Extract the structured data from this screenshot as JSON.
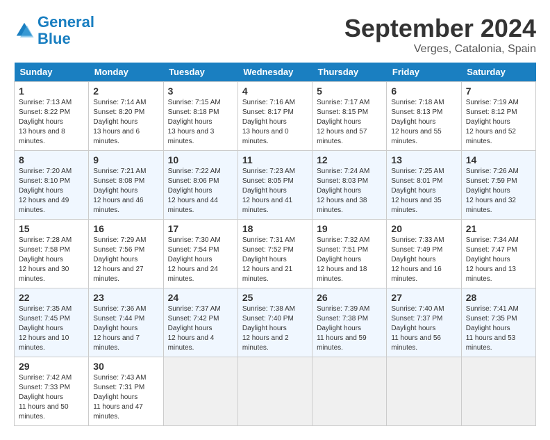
{
  "header": {
    "logo_line1": "General",
    "logo_line2": "Blue",
    "month": "September 2024",
    "location": "Verges, Catalonia, Spain"
  },
  "days_of_week": [
    "Sunday",
    "Monday",
    "Tuesday",
    "Wednesday",
    "Thursday",
    "Friday",
    "Saturday"
  ],
  "weeks": [
    [
      {
        "day": "1",
        "sunrise": "7:13 AM",
        "sunset": "8:22 PM",
        "daylight": "13 hours and 8 minutes."
      },
      {
        "day": "2",
        "sunrise": "7:14 AM",
        "sunset": "8:20 PM",
        "daylight": "13 hours and 6 minutes."
      },
      {
        "day": "3",
        "sunrise": "7:15 AM",
        "sunset": "8:18 PM",
        "daylight": "13 hours and 3 minutes."
      },
      {
        "day": "4",
        "sunrise": "7:16 AM",
        "sunset": "8:17 PM",
        "daylight": "13 hours and 0 minutes."
      },
      {
        "day": "5",
        "sunrise": "7:17 AM",
        "sunset": "8:15 PM",
        "daylight": "12 hours and 57 minutes."
      },
      {
        "day": "6",
        "sunrise": "7:18 AM",
        "sunset": "8:13 PM",
        "daylight": "12 hours and 55 minutes."
      },
      {
        "day": "7",
        "sunrise": "7:19 AM",
        "sunset": "8:12 PM",
        "daylight": "12 hours and 52 minutes."
      }
    ],
    [
      {
        "day": "8",
        "sunrise": "7:20 AM",
        "sunset": "8:10 PM",
        "daylight": "12 hours and 49 minutes."
      },
      {
        "day": "9",
        "sunrise": "7:21 AM",
        "sunset": "8:08 PM",
        "daylight": "12 hours and 46 minutes."
      },
      {
        "day": "10",
        "sunrise": "7:22 AM",
        "sunset": "8:06 PM",
        "daylight": "12 hours and 44 minutes."
      },
      {
        "day": "11",
        "sunrise": "7:23 AM",
        "sunset": "8:05 PM",
        "daylight": "12 hours and 41 minutes."
      },
      {
        "day": "12",
        "sunrise": "7:24 AM",
        "sunset": "8:03 PM",
        "daylight": "12 hours and 38 minutes."
      },
      {
        "day": "13",
        "sunrise": "7:25 AM",
        "sunset": "8:01 PM",
        "daylight": "12 hours and 35 minutes."
      },
      {
        "day": "14",
        "sunrise": "7:26 AM",
        "sunset": "7:59 PM",
        "daylight": "12 hours and 32 minutes."
      }
    ],
    [
      {
        "day": "15",
        "sunrise": "7:28 AM",
        "sunset": "7:58 PM",
        "daylight": "12 hours and 30 minutes."
      },
      {
        "day": "16",
        "sunrise": "7:29 AM",
        "sunset": "7:56 PM",
        "daylight": "12 hours and 27 minutes."
      },
      {
        "day": "17",
        "sunrise": "7:30 AM",
        "sunset": "7:54 PM",
        "daylight": "12 hours and 24 minutes."
      },
      {
        "day": "18",
        "sunrise": "7:31 AM",
        "sunset": "7:52 PM",
        "daylight": "12 hours and 21 minutes."
      },
      {
        "day": "19",
        "sunrise": "7:32 AM",
        "sunset": "7:51 PM",
        "daylight": "12 hours and 18 minutes."
      },
      {
        "day": "20",
        "sunrise": "7:33 AM",
        "sunset": "7:49 PM",
        "daylight": "12 hours and 16 minutes."
      },
      {
        "day": "21",
        "sunrise": "7:34 AM",
        "sunset": "7:47 PM",
        "daylight": "12 hours and 13 minutes."
      }
    ],
    [
      {
        "day": "22",
        "sunrise": "7:35 AM",
        "sunset": "7:45 PM",
        "daylight": "12 hours and 10 minutes."
      },
      {
        "day": "23",
        "sunrise": "7:36 AM",
        "sunset": "7:44 PM",
        "daylight": "12 hours and 7 minutes."
      },
      {
        "day": "24",
        "sunrise": "7:37 AM",
        "sunset": "7:42 PM",
        "daylight": "12 hours and 4 minutes."
      },
      {
        "day": "25",
        "sunrise": "7:38 AM",
        "sunset": "7:40 PM",
        "daylight": "12 hours and 2 minutes."
      },
      {
        "day": "26",
        "sunrise": "7:39 AM",
        "sunset": "7:38 PM",
        "daylight": "11 hours and 59 minutes."
      },
      {
        "day": "27",
        "sunrise": "7:40 AM",
        "sunset": "7:37 PM",
        "daylight": "11 hours and 56 minutes."
      },
      {
        "day": "28",
        "sunrise": "7:41 AM",
        "sunset": "7:35 PM",
        "daylight": "11 hours and 53 minutes."
      }
    ],
    [
      {
        "day": "29",
        "sunrise": "7:42 AM",
        "sunset": "7:33 PM",
        "daylight": "11 hours and 50 minutes."
      },
      {
        "day": "30",
        "sunrise": "7:43 AM",
        "sunset": "7:31 PM",
        "daylight": "11 hours and 47 minutes."
      },
      null,
      null,
      null,
      null,
      null
    ]
  ]
}
